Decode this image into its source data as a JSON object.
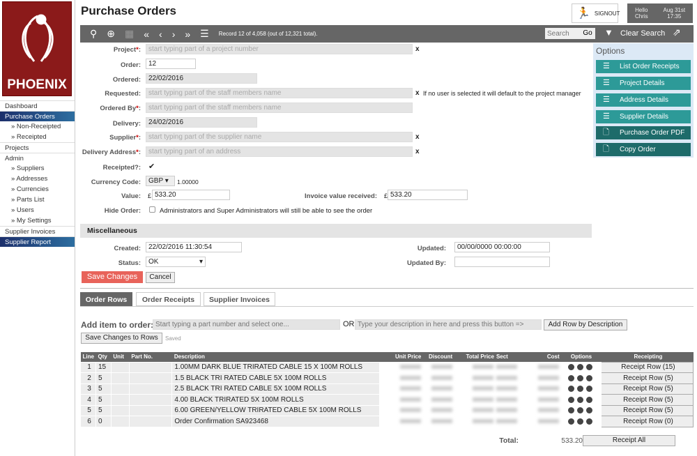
{
  "logo": {
    "text": "PHOENIX"
  },
  "sidebar": {
    "items": [
      {
        "label": "Dashboard"
      },
      {
        "label": "Purchase Orders",
        "active": true
      },
      {
        "label": "» Non-Receipted"
      },
      {
        "label": "» Receipted"
      },
      {
        "label": "Projects"
      },
      {
        "label": "Admin"
      },
      {
        "label": "» Suppliers"
      },
      {
        "label": "» Addresses"
      },
      {
        "label": "» Currencies"
      },
      {
        "label": "» Parts List"
      },
      {
        "label": "» Users"
      },
      {
        "label": "» My Settings"
      },
      {
        "label": "Supplier Invoices"
      },
      {
        "label": "Supplier Report",
        "active": true
      }
    ]
  },
  "header": {
    "title": "Purchase Orders",
    "signout": "SIGNOUT",
    "hello": "Hello",
    "user": "Chris",
    "date": "Aug 31st",
    "time": "17:35"
  },
  "toolbar": {
    "record": "Record 12 of 4,058 (out of 12,321 total).",
    "search_placeholder": "Search",
    "go": "Go",
    "clear_search": "Clear Search"
  },
  "form": {
    "project": {
      "label": "Project",
      "placeholder": "start typing part of a project number"
    },
    "order": {
      "label": "Order:",
      "value": "12"
    },
    "ordered": {
      "label": "Ordered:",
      "value": "22/02/2016"
    },
    "requested": {
      "label": "Requested:",
      "placeholder": "start typing part of the staff members name",
      "note": "If no user is selected it will default to the project manager"
    },
    "ordered_by": {
      "label": "Ordered By",
      "placeholder": "start typing part of the staff members name"
    },
    "delivery": {
      "label": "Delivery:",
      "value": "24/02/2016"
    },
    "supplier": {
      "label": "Supplier",
      "placeholder": "start typing part of the supplier name"
    },
    "delivery_address": {
      "label": "Delivery Address",
      "placeholder": "start typing part of an address"
    },
    "receipted": {
      "label": "Receipted?:",
      "checked": true
    },
    "currency": {
      "label": "Currency Code:",
      "value": "GBP",
      "rate": "1.00000"
    },
    "value": {
      "label": "Value:",
      "currency": "£",
      "value": "533.20"
    },
    "invoice_value": {
      "label": "Invoice value received:",
      "currency": "£",
      "value": "533.20"
    },
    "hide_order": {
      "label": "Hide Order:",
      "note": "Administrators and Super Administrators will still be able to see the order"
    },
    "clear_x": "x",
    "req_mark": "*"
  },
  "options": {
    "title": "Options",
    "items": [
      "List Order Receipts",
      "Project Details",
      "Address Details",
      "Supplier Details",
      "Purchase Order PDF",
      "Copy Order"
    ]
  },
  "misc": {
    "title": "Miscellaneous",
    "created_label": "Created:",
    "created": "22/02/2016 11:30:54",
    "updated_label": "Updated:",
    "updated": "00/00/0000 00:00:00",
    "status_label": "Status:",
    "status": "OK",
    "updated_by_label": "Updated By:",
    "updated_by": ""
  },
  "actions": {
    "save": "Save Changes",
    "cancel": "Cancel"
  },
  "tabs": [
    "Order Rows",
    "Order Receipts",
    "Supplier Invoices"
  ],
  "add_item": {
    "label": "Add item to order:",
    "part_placeholder": "Start typing a part number and select one...",
    "or": "OR",
    "desc_placeholder": "Type your description in here and press this button =>",
    "add_button": "Add Row by Description",
    "save_rows": "Save Changes to Rows",
    "saved": "Saved"
  },
  "table": {
    "headers": [
      "Line",
      "Qty",
      "Unit",
      "Part No.",
      "Description",
      "Unit Price",
      "Discount",
      "Total Price",
      "Sect",
      "Cost",
      "Options",
      "Receipting"
    ],
    "rows": [
      {
        "line": "1",
        "qty": "15",
        "unit": "",
        "part": "",
        "desc": "1.00MM DARK BLUE TRIRATED CABLE 15 X 100M ROLLS",
        "receipt": "Receipt Row (15)"
      },
      {
        "line": "2",
        "qty": "5",
        "unit": "",
        "part": "",
        "desc": "1.5 BLACK TRI RATED  CABLE 5X 100M ROLLS",
        "receipt": "Receipt Row (5)"
      },
      {
        "line": "3",
        "qty": "5",
        "unit": "",
        "part": "",
        "desc": "2.5  BLACK TRI RATED  CABLE  5X 100M ROLLS",
        "receipt": "Receipt Row (5)"
      },
      {
        "line": "4",
        "qty": "5",
        "unit": "",
        "part": "",
        "desc": "4.00 BLACK TRIRATED    5X 100M ROLLS",
        "receipt": "Receipt Row (5)"
      },
      {
        "line": "5",
        "qty": "5",
        "unit": "",
        "part": "",
        "desc": "6.00 GREEN/YELLOW TRIRATED CABLE  5X 100M ROLLS",
        "receipt": "Receipt Row (5)"
      },
      {
        "line": "6",
        "qty": "0",
        "unit": "",
        "part": "",
        "desc": "Order Confirmation SA923468",
        "receipt": "Receipt Row (0)"
      }
    ],
    "total_label": "Total:",
    "total": "533.20",
    "receipt_all": "Receipt All"
  },
  "colors": {
    "toolbar": "#666666",
    "options_teal": "#2d9a98",
    "options_dark": "#1e6b6a",
    "save": "#e8635a",
    "logo": "#8b1a1a",
    "nav_active": "#1c2f6b"
  }
}
